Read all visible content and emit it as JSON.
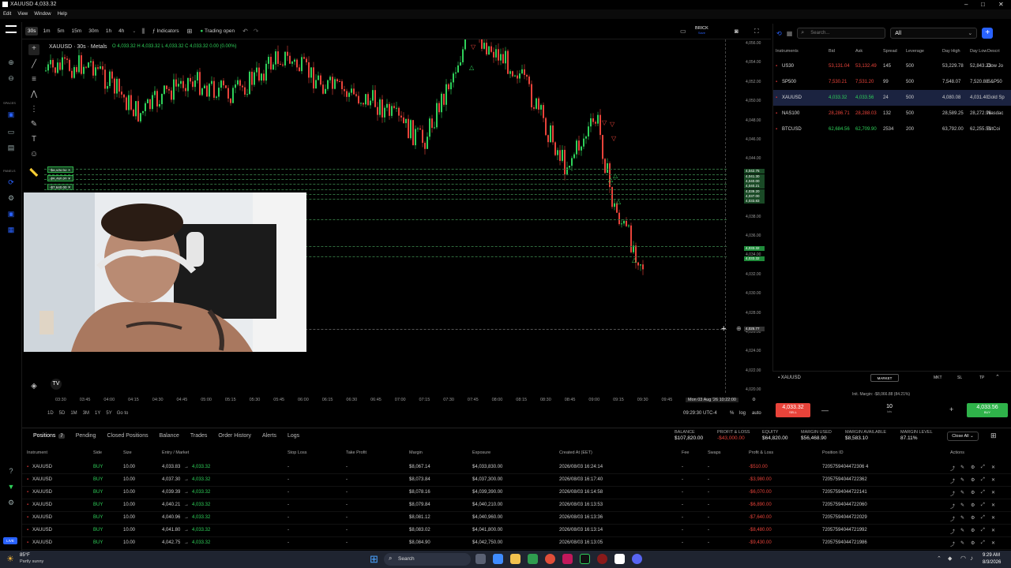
{
  "window": {
    "title": "XAUUSD 4,033.32"
  },
  "menu": [
    "Edit",
    "View",
    "Window",
    "Help"
  ],
  "toolbar": {
    "timeframes": [
      "30s",
      "1m",
      "5m",
      "15m",
      "30m",
      "1h",
      "4h"
    ],
    "active_timeframe": "30s",
    "indicators_label": "Indicators",
    "trading_status": "Trading open",
    "brick_label": "BRICK",
    "brick_sub": "Save"
  },
  "chart": {
    "legend_symbol": "XAUUSD · 30s · Metals",
    "ohlc": "O 4,033.32  H 4,033.32  L 4,033.32  C 4,033.32  0.00 (0.00%)",
    "price_ticks": [
      "4,056.00",
      "4,054.00",
      "4,052.00",
      "4,050.00",
      "4,048.00",
      "4,046.00",
      "4,044.00",
      "4,042.00",
      "4,040.00",
      "4,038.00",
      "4,036.00",
      "4,034.00",
      "4,032.00",
      "4,030.00",
      "4,028.00",
      "4,026.00",
      "4,024.00",
      "4,022.00",
      "4,020.00"
    ],
    "line_labels": [
      "4,042.75",
      "4,041.30",
      "4,040.00",
      "4,040.21",
      "4,039.20",
      "4,037.00",
      "4,033.83",
      "4,033.32",
      "4,033.32"
    ],
    "crosshair_label": "4,025.77",
    "time_ticks": [
      "03:30",
      "03:45",
      "04:00",
      "04:15",
      "04:30",
      "04:45",
      "05:00",
      "05:15",
      "05:30",
      "05:45",
      "06:00",
      "06:15",
      "06:30",
      "06:45",
      "07:00",
      "07:15",
      "07:30",
      "07:45",
      "08:00",
      "08:15",
      "08:30",
      "08:45",
      "09:00",
      "09:15",
      "09:30",
      "09:45"
    ],
    "crosshair_time": "Mon 03 Aug '26   10:22:00",
    "position_tags": [
      "-$9,430.00",
      "-$8,480.00",
      "-$7,640.00",
      "-$6,890.00"
    ],
    "ranges": [
      "1D",
      "5D",
      "1M",
      "3M",
      "1Y",
      "5Y"
    ],
    "goto": "Go to",
    "clock": "09:29:30 UTC-4",
    "axis_opts": [
      "%",
      "log",
      "auto"
    ]
  },
  "sidebar_labels": {
    "spaces": "SPACES",
    "panels": "PANELS"
  },
  "instruments_panel": {
    "search_placeholder": "Search...",
    "filter": "All",
    "headers": [
      "Instruments",
      "Bid",
      "Ask",
      "Spread",
      "Leverage",
      "Day High",
      "Day Low",
      "Descri"
    ],
    "rows": [
      {
        "name": "US30",
        "bid": "53,131.04",
        "ask": "53,132.49",
        "spread": "145",
        "lev": "500",
        "high": "53,229.78",
        "low": "52,843.23",
        "desc": "Dow Jo",
        "bidc": "#e8433a",
        "askc": "#e8433a",
        "selected": false
      },
      {
        "name": "SP500",
        "bid": "7,530.21",
        "ask": "7,531.20",
        "spread": "99",
        "lev": "500",
        "high": "7,548.07",
        "low": "7,520.88",
        "desc": "S&P50",
        "bidc": "#e8433a",
        "askc": "#e8433a",
        "selected": false
      },
      {
        "name": "XAUUSD",
        "bid": "4,033.32",
        "ask": "4,033.56",
        "spread": "24",
        "lev": "500",
        "high": "4,080.08",
        "low": "4,031.40",
        "desc": "Gold Sp",
        "bidc": "#2fd15a",
        "askc": "#2fd15a",
        "selected": true
      },
      {
        "name": "NAS100",
        "bid": "28,286.71",
        "ask": "28,288.03",
        "spread": "132",
        "lev": "500",
        "high": "28,589.25",
        "low": "28,272.96",
        "desc": "Nasdac",
        "bidc": "#e8433a",
        "askc": "#e8433a",
        "selected": false
      },
      {
        "name": "BTCUSD",
        "bid": "62,684.56",
        "ask": "62,709.90",
        "spread": "2534",
        "lev": "200",
        "high": "63,792.00",
        "low": "62,255.51",
        "desc": "BitCoi",
        "bidc": "#2fd15a",
        "askc": "#2fd15a",
        "selected": false
      }
    ]
  },
  "order_panel": {
    "symbol": "XAUUSD",
    "order_type": "MARKET",
    "tabs": [
      "MKT",
      "SL",
      "TP"
    ],
    "margin": "Init. Margin: -$8,066.88 (84.21%)",
    "sell_price": "4,033.32",
    "sell_label": "SELL",
    "buy_price": "4,033.56",
    "buy_label": "BUY",
    "qty": "10",
    "qty_unit": "lots"
  },
  "bottom": {
    "tabs": [
      "Positions",
      "Pending",
      "Closed Positions",
      "Balance",
      "Trades",
      "Order History",
      "Alerts",
      "Logs"
    ],
    "positions_count": "7",
    "summary": [
      {
        "label": "BALANCE",
        "value": "$107,820.00",
        "color": "#eeeeee"
      },
      {
        "label": "PROFIT & LOSS",
        "value": "-$43,000.00",
        "color": "#e8433a"
      },
      {
        "label": "EQUITY",
        "value": "$64,820.00",
        "color": "#eeeeee"
      },
      {
        "label": "MARGIN USED",
        "value": "$56,468.90",
        "color": "#eeeeee"
      },
      {
        "label": "MARGIN AVAILABLE",
        "value": "$8,583.10",
        "color": "#eeeeee"
      },
      {
        "label": "MARGIN LEVEL",
        "value": "87.11%",
        "color": "#eeeeee"
      }
    ],
    "close_all": "Close All",
    "columns": [
      "Instrument",
      "Side",
      "Size",
      "Entry / Market",
      "Stop Loss",
      "Take Profit",
      "Margin",
      "Exposure",
      "Created At (EET)",
      "Fee",
      "Swaps",
      "Profit & Loss",
      "Position ID",
      "Actions"
    ],
    "rows": [
      {
        "inst": "XAUUSD",
        "side": "BUY",
        "size": "10.00",
        "entry": "4,033.83",
        "market": "4,033.32",
        "sl": "-",
        "tp": "-",
        "margin": "$8,067.14",
        "exposure": "$4,033,830.00",
        "created": "2026/08/03 16:24:14",
        "fee": "-",
        "swaps": "-",
        "pl": "-$510.00",
        "id": "7205759404472306 4"
      },
      {
        "inst": "XAUUSD",
        "side": "BUY",
        "size": "10.00",
        "entry": "4,037.30",
        "market": "4,033.32",
        "sl": "-",
        "tp": "-",
        "margin": "$8,073.84",
        "exposure": "$4,037,300.00",
        "created": "2026/08/03 16:17:40",
        "fee": "-",
        "swaps": "-",
        "pl": "-$3,980.00",
        "id": "72057594044722362"
      },
      {
        "inst": "XAUUSD",
        "side": "BUY",
        "size": "10.00",
        "entry": "4,039.39",
        "market": "4,033.32",
        "sl": "-",
        "tp": "-",
        "margin": "$8,078.16",
        "exposure": "$4,039,390.00",
        "created": "2026/08/03 16:14:58",
        "fee": "-",
        "swaps": "-",
        "pl": "-$6,070.00",
        "id": "72057594044722141"
      },
      {
        "inst": "XAUUSD",
        "side": "BUY",
        "size": "10.00",
        "entry": "4,040.21",
        "market": "4,033.32",
        "sl": "-",
        "tp": "-",
        "margin": "$8,079.84",
        "exposure": "$4,040,210.00",
        "created": "2026/08/03 16:13:53",
        "fee": "-",
        "swaps": "-",
        "pl": "-$6,890.00",
        "id": "72057594044722060"
      },
      {
        "inst": "XAUUSD",
        "side": "BUY",
        "size": "10.00",
        "entry": "4,040.96",
        "market": "4,033.32",
        "sl": "-",
        "tp": "-",
        "margin": "$8,081.12",
        "exposure": "$4,040,960.00",
        "created": "2026/08/03 16:13:36",
        "fee": "-",
        "swaps": "-",
        "pl": "-$7,640.00",
        "id": "72057594044722029"
      },
      {
        "inst": "XAUUSD",
        "side": "BUY",
        "size": "10.00",
        "entry": "4,041.80",
        "market": "4,033.32",
        "sl": "-",
        "tp": "-",
        "margin": "$8,083.02",
        "exposure": "$4,041,800.00",
        "created": "2026/08/03 16:13:14",
        "fee": "-",
        "swaps": "-",
        "pl": "-$8,480.00",
        "id": "72057594044721992"
      },
      {
        "inst": "XAUUSD",
        "side": "BUY",
        "size": "10.00",
        "entry": "4,042.75",
        "market": "4,033.32",
        "sl": "-",
        "tp": "-",
        "margin": "$8,084.90",
        "exposure": "$4,042,750.00",
        "created": "2026/08/03 16:13:05",
        "fee": "-",
        "swaps": "-",
        "pl": "-$9,430.00",
        "id": "72057594044721986"
      }
    ]
  },
  "taskbar": {
    "weather_temp": "85°F",
    "weather_desc": "Partly sunny",
    "search": "Search",
    "time": "9:29 AM",
    "date": "8/3/2026",
    "live": "LIVE"
  },
  "colors": {
    "up": "#2fd15a",
    "down": "#e8433a",
    "accent": "#2962ff",
    "bg": "#000000"
  }
}
